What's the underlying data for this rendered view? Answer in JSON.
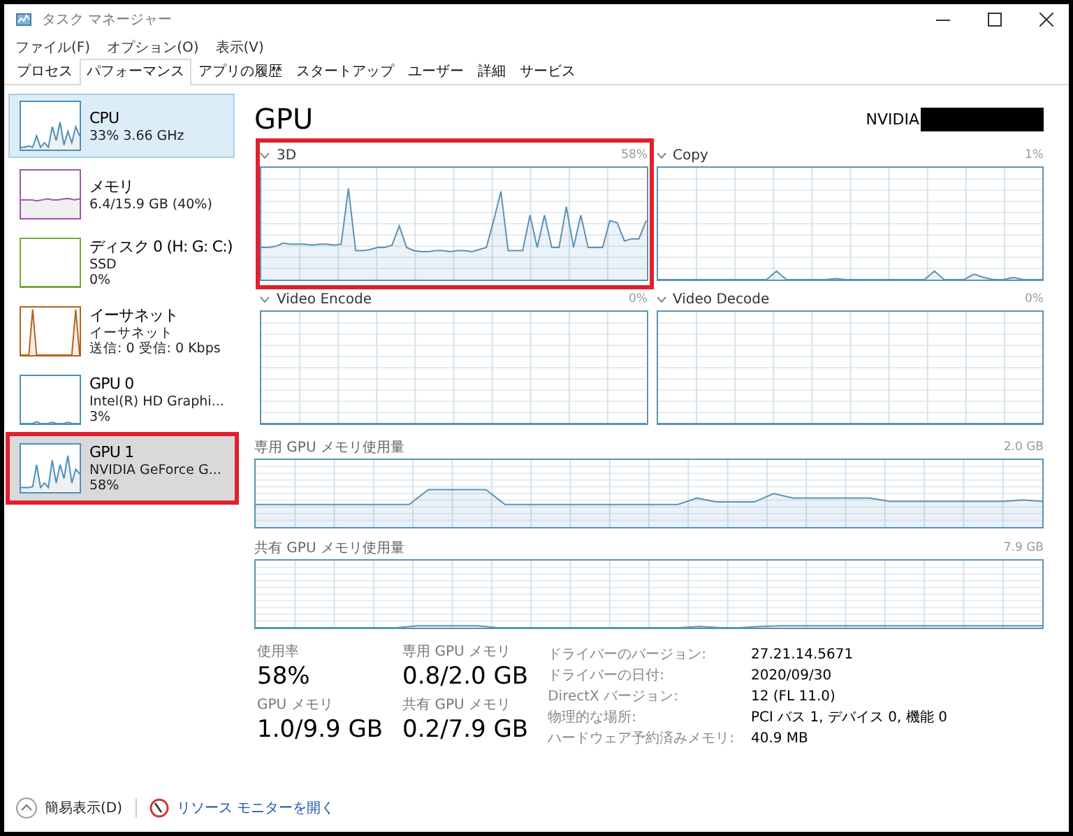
{
  "window": {
    "title": "タスク マネージャー"
  },
  "menu": [
    "ファイル(F)",
    "オプション(O)",
    "表示(V)"
  ],
  "tabs": [
    {
      "label": "プロセス",
      "selected": false
    },
    {
      "label": "パフォーマンス",
      "selected": true
    },
    {
      "label": "アプリの履歴",
      "selected": false
    },
    {
      "label": "スタートアップ",
      "selected": false
    },
    {
      "label": "ユーザー",
      "selected": false
    },
    {
      "label": "詳細",
      "selected": false
    },
    {
      "label": "サービス",
      "selected": false
    }
  ],
  "sidebar": {
    "items": [
      {
        "name": "CPU",
        "details": [
          "33%  3.66 GHz"
        ],
        "color": "#4a90c0",
        "selected": false,
        "hovered": true,
        "highlighted": false
      },
      {
        "name": "メモリ",
        "details": [
          "6.4/15.9 GB (40%)"
        ],
        "color": "#a452b0",
        "selected": false,
        "hovered": false,
        "highlighted": false
      },
      {
        "name": "ディスク 0 (H: G: C:)",
        "details": [
          "SSD",
          "0%"
        ],
        "color": "#78a838",
        "selected": false,
        "hovered": false,
        "highlighted": false
      },
      {
        "name": "イーサネット",
        "details": [
          "イーサネット",
          "送信: 0 受信: 0 Kbps"
        ],
        "color": "#b8621a",
        "selected": false,
        "hovered": false,
        "highlighted": false
      },
      {
        "name": "GPU 0",
        "details": [
          "Intel(R) HD Graphi...",
          "3%"
        ],
        "color": "#4a90c0",
        "selected": false,
        "hovered": false,
        "highlighted": false
      },
      {
        "name": "GPU 1",
        "details": [
          "NVIDIA GeForce G...",
          "58%"
        ],
        "color": "#4a90c0",
        "selected": true,
        "hovered": false,
        "highlighted": true
      }
    ]
  },
  "main": {
    "title": "GPU",
    "device": "NVIDIA",
    "redacted": true,
    "engine_graphs": [
      {
        "label": "3D",
        "reading": "58%",
        "highlighted": true
      },
      {
        "label": "Copy",
        "reading": "1%",
        "highlighted": false
      },
      {
        "label": "Video Encode",
        "reading": "0%",
        "highlighted": false
      },
      {
        "label": "Video Decode",
        "reading": "0%",
        "highlighted": false
      }
    ],
    "memory_graphs": [
      {
        "label": "専用 GPU メモリ使用量",
        "reading": "2.0 GB"
      },
      {
        "label": "共有 GPU メモリ使用量",
        "reading": "7.9 GB"
      }
    ],
    "stats": [
      {
        "label": "使用率",
        "value": "58%"
      },
      {
        "label": "専用 GPU メモリ",
        "value": "0.8/2.0 GB"
      },
      {
        "label": "GPU メモリ",
        "value": "1.0/9.9 GB"
      },
      {
        "label": "共有 GPU メモリ",
        "value": "0.2/7.9 GB"
      }
    ],
    "properties": [
      {
        "label": "ドライバーのバージョン:",
        "value": "27.21.14.5671"
      },
      {
        "label": "ドライバーの日付:",
        "value": "2020/09/30"
      },
      {
        "label": "DirectX バージョン:",
        "value": "12 (FL 11.0)"
      },
      {
        "label": "物理的な場所:",
        "value": "PCI バス 1, デバイス 0, 機能 0"
      },
      {
        "label": "ハードウェア予約済みメモリ:",
        "value": "40.9 MB"
      }
    ]
  },
  "footer": {
    "fewer_details": "簡易表示(D)",
    "resource_monitor": "リソース モニターを開く"
  }
}
